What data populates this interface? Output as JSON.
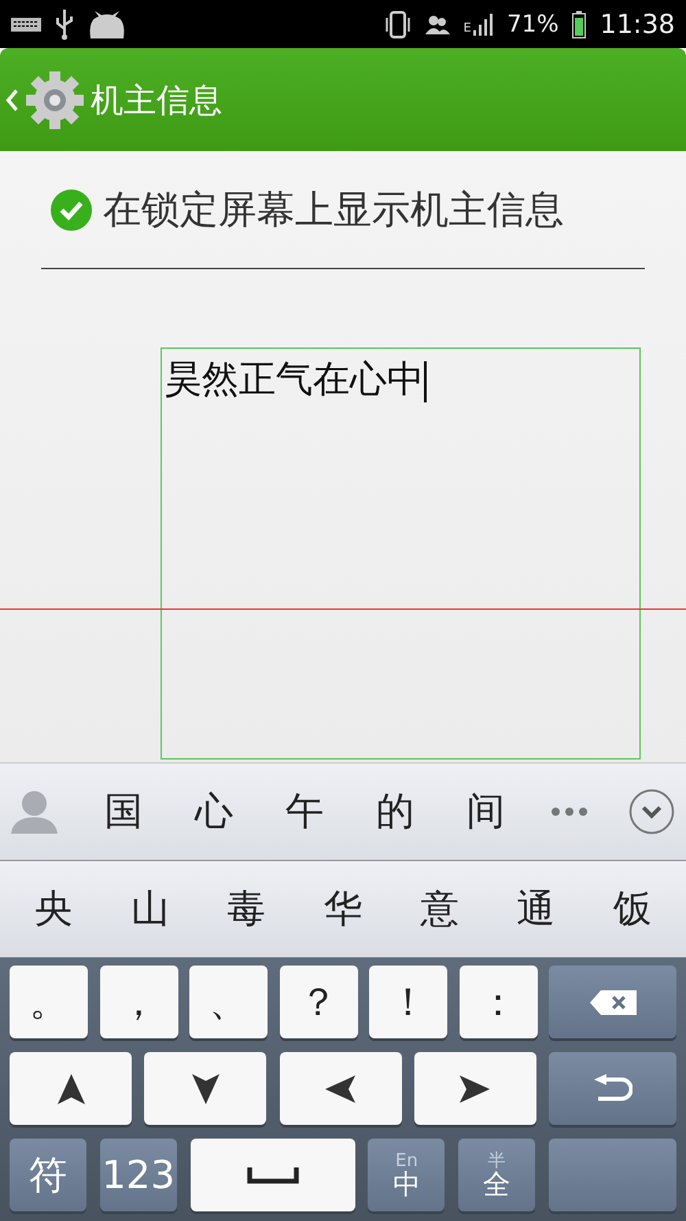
{
  "status_bar": {
    "network": "E",
    "battery": "71%",
    "time": "11:38"
  },
  "app_bar": {
    "title": "机主信息"
  },
  "show_on_lock_screen": {
    "label": "在锁定屏幕上显示机主信息",
    "checked": true
  },
  "owner_info_field": {
    "value": "昊然正气在心中"
  },
  "candidates": [
    "国",
    "心",
    "午",
    "的",
    "间"
  ],
  "suggestions": [
    "央",
    "山",
    "毒",
    "华",
    "意",
    "通",
    "饭"
  ],
  "keyboard_rows": [
    [
      {
        "kind": "char",
        "label": "。"
      },
      {
        "kind": "char",
        "label": "，"
      },
      {
        "kind": "char",
        "label": "、"
      },
      {
        "kind": "char",
        "label": "？"
      },
      {
        "kind": "char",
        "label": "！"
      },
      {
        "kind": "char",
        "label": "："
      },
      {
        "kind": "backspace"
      }
    ],
    [
      {
        "kind": "up"
      },
      {
        "kind": "down"
      },
      {
        "kind": "left"
      },
      {
        "kind": "right"
      },
      {
        "kind": "enter"
      }
    ],
    [
      {
        "kind": "fn",
        "label": "符"
      },
      {
        "kind": "fn",
        "label": "123"
      },
      {
        "kind": "space"
      },
      {
        "kind": "toggle",
        "top": "En",
        "label": "中"
      },
      {
        "kind": "toggle",
        "top": "半",
        "label": "全"
      },
      {
        "kind": "blank"
      }
    ]
  ]
}
